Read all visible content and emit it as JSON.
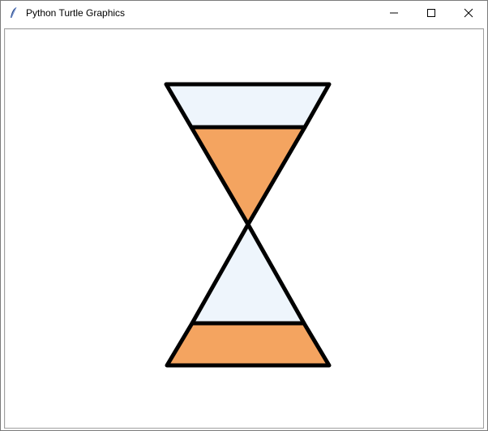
{
  "window": {
    "title": "Python Turtle Graphics",
    "app_icon": "feather-icon",
    "controls": {
      "minimize_icon": "minimize-icon",
      "maximize_icon": "maximize-icon",
      "close_icon": "close-icon"
    }
  },
  "drawing": {
    "shape": "hourglass",
    "glass_color": "#eef5fc",
    "sand_color": "#f4a460",
    "outline_color": "#000000"
  }
}
